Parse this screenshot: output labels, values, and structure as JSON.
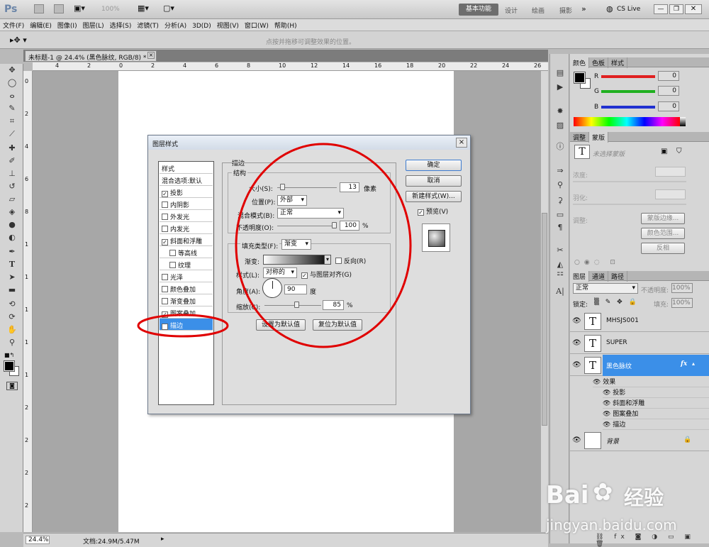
{
  "app": {
    "logo": "Ps",
    "zoom_display": "100%",
    "workspace_active": "基本功能",
    "workspaces": [
      "设计",
      "绘画",
      "摄影"
    ],
    "cslive": "CS Live"
  },
  "menu": [
    "文件(F)",
    "编辑(E)",
    "图像(I)",
    "图层(L)",
    "选择(S)",
    "滤镜(T)",
    "分析(A)",
    "3D(D)",
    "视图(V)",
    "窗口(W)",
    "帮助(H)"
  ],
  "options": {
    "hint": "点按并拖移可调整效果的位置。"
  },
  "document": {
    "tab": "未标题-1 @ 24.4% (黑色脉纹, RGB/8) *",
    "close": "×"
  },
  "ruler_h": [
    "4",
    "2",
    "0",
    "2",
    "4",
    "6",
    "8",
    "10",
    "12",
    "14",
    "16",
    "18",
    "20",
    "22",
    "24",
    "26"
  ],
  "ruler_v": [
    "0",
    "2",
    "4",
    "6",
    "8",
    "1",
    "1",
    "1",
    "1",
    "1",
    "2",
    "2",
    "2",
    "2"
  ],
  "status": {
    "zoom": "24.4%",
    "doc": "文档:24.9M/5.47M"
  },
  "dialog": {
    "title": "图层样式",
    "close": "×",
    "styles_header": "样式",
    "styles": [
      {
        "label": "混合选项:默认",
        "checked": null
      },
      {
        "label": "投影",
        "checked": true
      },
      {
        "label": "内阴影",
        "checked": false
      },
      {
        "label": "外发光",
        "checked": false
      },
      {
        "label": "内发光",
        "checked": false
      },
      {
        "label": "斜面和浮雕",
        "checked": true
      },
      {
        "label": "等高线",
        "checked": false
      },
      {
        "label": "纹理",
        "checked": false
      },
      {
        "label": "光泽",
        "checked": false
      },
      {
        "label": "颜色叠加",
        "checked": false
      },
      {
        "label": "渐变叠加",
        "checked": false
      },
      {
        "label": "图案叠加",
        "checked": true
      },
      {
        "label": "描边",
        "checked": true
      }
    ],
    "section_title": "描边",
    "structure_title": "结构",
    "size_label": "大小(S):",
    "size_value": "13",
    "size_unit": "像素",
    "size_fraction": 0.05,
    "position_label": "位置(P):",
    "position_value": "外部",
    "blend_label": "混合模式(B):",
    "blend_value": "正常",
    "opacity_label": "不透明度(O):",
    "opacity_value": "100",
    "opacity_unit": "%",
    "opacity_fraction": 1.0,
    "fill_type_label": "填充类型(F):",
    "fill_type_value": "渐变",
    "gradient_label": "渐变:",
    "reverse_label": "反向(R)",
    "reverse_checked": false,
    "style_label": "样式(L):",
    "style_value": "对称的",
    "align_label": "与图层对齐(G)",
    "align_checked": true,
    "angle_label": "角度(A):",
    "angle_value": "90",
    "angle_unit": "度",
    "scale_label": "缩放(C):",
    "scale_value": "85",
    "scale_unit": "%",
    "scale_fraction": 0.57,
    "set_default": "设置为默认值",
    "reset_default": "复位为默认值",
    "ok": "确定",
    "cancel": "取消",
    "new_style": "新建样式(W)...",
    "preview_label": "预览(V)",
    "preview_checked": true
  },
  "panels": {
    "color_tabs": [
      "颜色",
      "色板",
      "样式"
    ],
    "color_channels": [
      {
        "label": "R",
        "value": "0",
        "color": "#e02020"
      },
      {
        "label": "G",
        "value": "0",
        "color": "#20b020"
      },
      {
        "label": "B",
        "value": "0",
        "color": "#2030d0"
      }
    ],
    "adjust_tabs": [
      "调整",
      "蒙版"
    ],
    "mask_caption": "未选择蒙版",
    "density_label": "浓度:",
    "feather_label": "羽化:",
    "refine_label": "调整:",
    "mask_edge": "蒙版边缘...",
    "color_range": "颜色范围...",
    "invert": "反相",
    "layers_tabs": [
      "图层",
      "通道",
      "路径"
    ],
    "blend_mode": "正常",
    "opacity_label": "不透明度:",
    "opacity_value": "100%",
    "lock_label": "锁定:",
    "fill_label": "填充:",
    "fill_value": "100%",
    "layers": [
      {
        "name": "MHSJS001",
        "thumb": "T",
        "selected": false
      },
      {
        "name": "SUPER",
        "thumb": "T",
        "selected": false
      },
      {
        "name": "黑色脉纹",
        "thumb": "T",
        "selected": true,
        "fx": "fx"
      }
    ],
    "effects_label": "效果",
    "effects": [
      "投影",
      "斜面和浮雕",
      "图案叠加",
      "描边"
    ],
    "background_name": "背景"
  },
  "watermark": {
    "brand": "Bai",
    "brand2": "经验",
    "url": "jingyan.baidu.com"
  }
}
